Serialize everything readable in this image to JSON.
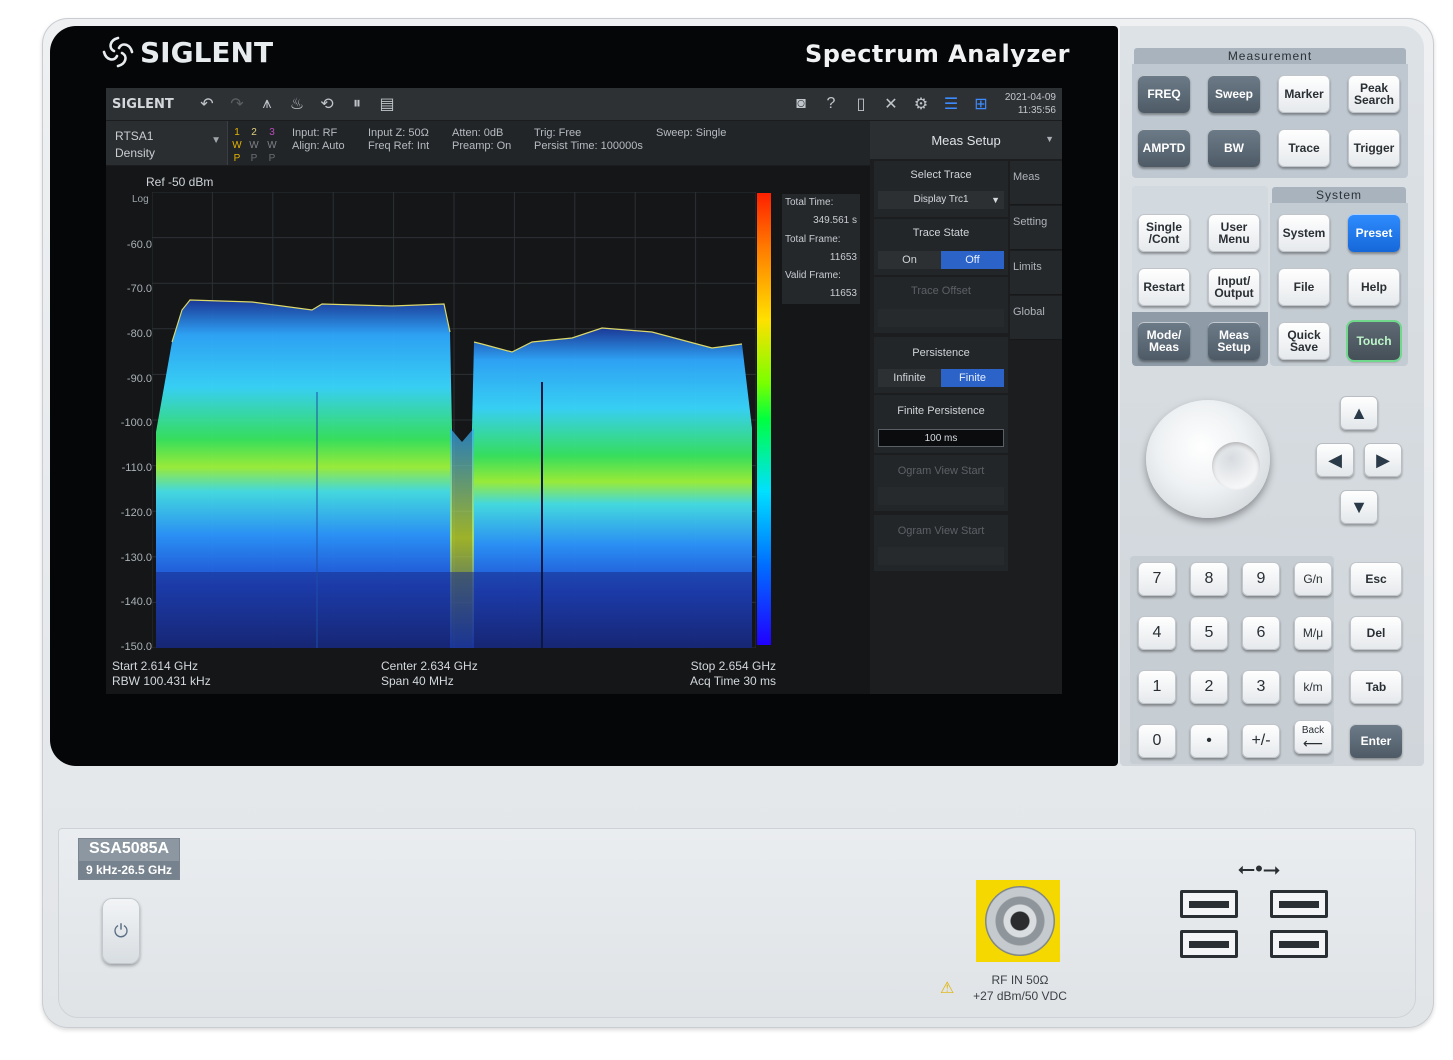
{
  "brand": {
    "logo_text": "SIGLENT",
    "product_title": "Spectrum Analyzer"
  },
  "toolbar": {
    "logo_text": "SIGLENT",
    "date": "2021-04-09",
    "time": "11:35:56"
  },
  "mode": {
    "name": "RTSA1",
    "view": "Density"
  },
  "traces": [
    {
      "num": "1",
      "mode": "W",
      "det": "P",
      "color": "#e6b400"
    },
    {
      "num": "2",
      "mode": "W",
      "det": "P",
      "color": "#e0c060"
    },
    {
      "num": "3",
      "mode": "W",
      "det": "P",
      "color": "#b84db8"
    }
  ],
  "status": {
    "input": "Input: RF",
    "align": "Align: Auto",
    "input_z": "Input Z: 50Ω",
    "freq_ref": "Freq Ref: Int",
    "atten": "Atten: 0dB",
    "preamp": "Preamp: On",
    "trig": "Trig: Free",
    "persist_time": "Persist Time: 100000s",
    "sweep": "Sweep: Single"
  },
  "plot": {
    "ref": "Ref  -50 dBm",
    "scale": "Log",
    "y_labels": [
      "-60.0",
      "-70.0",
      "-80.0",
      "-90.0",
      "-100.0",
      "-110.0",
      "-120.0",
      "-130.0",
      "-140.0",
      "-150.0"
    ]
  },
  "stats": {
    "total_time_label": "Total Time:",
    "total_time_value": "349.561 s",
    "total_frame_label": "Total Frame:",
    "total_frame_value": "11653",
    "valid_frame_label": "Valid Frame:",
    "valid_frame_value": "11653"
  },
  "footer": {
    "start": "Start  2.614 GHz",
    "rbw": "RBW  100.431 kHz",
    "center": "Center  2.634 GHz",
    "span": "Span  40 MHz",
    "stop": "Stop  2.654 GHz",
    "acq_time": "Acq Time  30 ms"
  },
  "menu": {
    "header": "Meas Setup",
    "select_trace_label": "Select Trace",
    "select_trace_value": "Display Trc1",
    "trace_state_label": "Trace State",
    "trace_state_on": "On",
    "trace_state_off": "Off",
    "trace_offset_label": "Trace Offset",
    "persistence_label": "Persistence",
    "persistence_infinite": "Infinite",
    "persistence_finite": "Finite",
    "finite_persistence_label": "Finite Persistence",
    "finite_persistence_value": "100 ms",
    "ogram_view_start_1": "Ogram View Start",
    "ogram_view_start_2": "Ogram View Start",
    "side_tabs": [
      "Meas",
      "Setting",
      "Limits",
      "Global"
    ]
  },
  "keys": {
    "measurement_title": "Measurement",
    "system_title": "System",
    "freq": "FREQ",
    "sweep": "Sweep",
    "marker": "Marker",
    "peak_search": "Peak Search",
    "amptd": "AMPTD",
    "bw": "BW",
    "trace": "Trace",
    "trigger": "Trigger",
    "single_cont": "Single /Cont",
    "user_menu": "User Menu",
    "system": "System",
    "preset": "Preset",
    "restart": "Restart",
    "input_output": "Input/ Output",
    "file": "File",
    "help": "Help",
    "mode_meas": "Mode/ Meas",
    "meas_setup": "Meas Setup",
    "quick_save": "Quick Save",
    "touch": "Touch",
    "num": [
      "7",
      "8",
      "9",
      "4",
      "5",
      "6",
      "1",
      "2",
      "3",
      "0",
      "•",
      "+/-"
    ],
    "units": [
      "G/n",
      "M/μ",
      "k/m",
      "Back"
    ],
    "side": [
      "Esc",
      "Del",
      "Tab",
      "Enter"
    ]
  },
  "front": {
    "model": "SSA5085A",
    "range": "9 kHz-26.5 GHz",
    "rf_in": "RF IN 50Ω",
    "rf_limit": "+27 dBm/50 VDC"
  }
}
